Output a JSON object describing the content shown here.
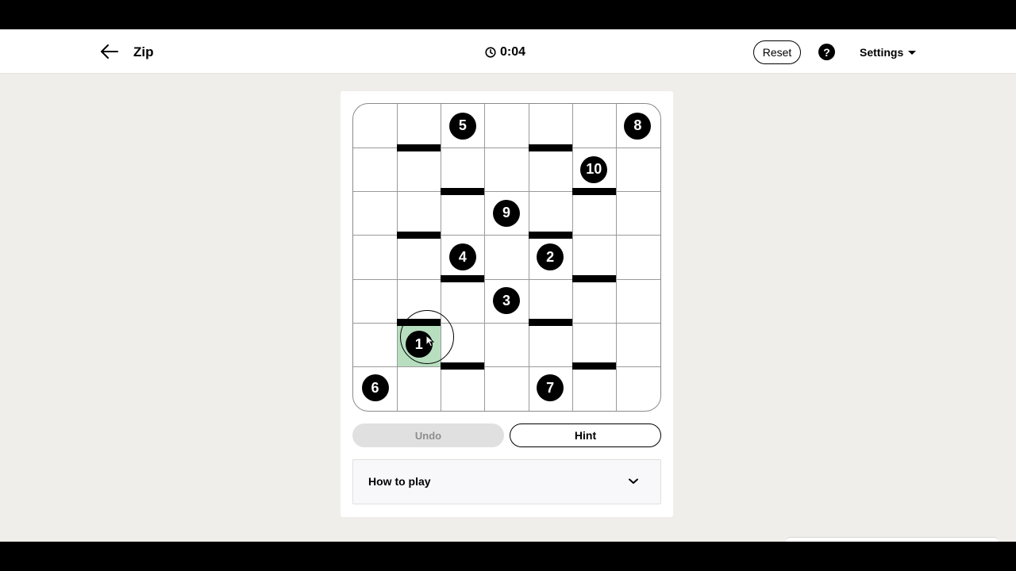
{
  "header": {
    "back_icon": "arrow-left-icon",
    "title": "Zip",
    "timer_icon": "clock-icon",
    "timer": "0:04",
    "reset_label": "Reset",
    "help_symbol": "?",
    "settings_label": "Settings"
  },
  "board": {
    "rows": 7,
    "cols": 7,
    "numbers": [
      {
        "value": "5",
        "row": 0,
        "col": 2
      },
      {
        "value": "8",
        "row": 0,
        "col": 6
      },
      {
        "value": "10",
        "row": 1,
        "col": 5
      },
      {
        "value": "9",
        "row": 2,
        "col": 3
      },
      {
        "value": "4",
        "row": 3,
        "col": 2
      },
      {
        "value": "2",
        "row": 3,
        "col": 4
      },
      {
        "value": "3",
        "row": 4,
        "col": 3
      },
      {
        "value": "1",
        "row": 5,
        "col": 1
      },
      {
        "value": "6",
        "row": 6,
        "col": 0
      },
      {
        "value": "7",
        "row": 6,
        "col": 4
      }
    ],
    "walls_below": [
      {
        "row": 0,
        "col": 1
      },
      {
        "row": 0,
        "col": 4
      },
      {
        "row": 1,
        "col": 2
      },
      {
        "row": 1,
        "col": 5
      },
      {
        "row": 2,
        "col": 1
      },
      {
        "row": 2,
        "col": 4
      },
      {
        "row": 3,
        "col": 2
      },
      {
        "row": 3,
        "col": 5
      },
      {
        "row": 4,
        "col": 1
      },
      {
        "row": 4,
        "col": 4
      },
      {
        "row": 5,
        "col": 2
      },
      {
        "row": 5,
        "col": 5
      }
    ],
    "filled_cells": [
      {
        "row": 5,
        "col": 1
      }
    ],
    "path_color": "#b7dfbf"
  },
  "controls": {
    "undo_label": "Undo",
    "hint_label": "Hint"
  },
  "howto": {
    "label": "How to play",
    "chevron_icon": "chevron-down-icon"
  }
}
